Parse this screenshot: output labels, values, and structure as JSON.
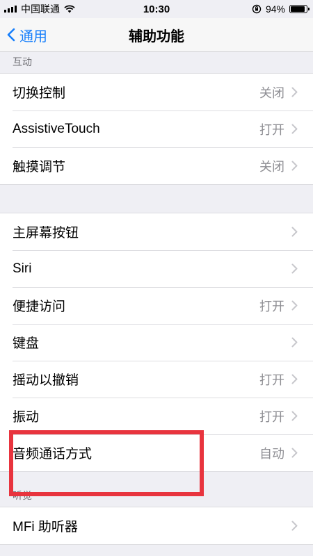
{
  "status_bar": {
    "carrier": "中国联通",
    "time": "10:30",
    "battery_text": "94%",
    "battery_level": 0.94,
    "icons": [
      "signal-icon",
      "wifi-icon",
      "orientation-lock-icon",
      "battery-icon"
    ]
  },
  "nav": {
    "back_label": "通用",
    "title": "辅助功能"
  },
  "sections": {
    "interaction": {
      "header": "互动",
      "rows": [
        {
          "label": "切换控制",
          "value": "关闭"
        },
        {
          "label": "AssistiveTouch",
          "value": "打开"
        },
        {
          "label": "触摸调节",
          "value": "关闭"
        }
      ]
    },
    "general": {
      "rows": [
        {
          "label": "主屏幕按钮",
          "value": ""
        },
        {
          "label": "Siri",
          "value": ""
        },
        {
          "label": "便捷访问",
          "value": "打开"
        },
        {
          "label": "键盘",
          "value": ""
        },
        {
          "label": "摇动以撤销",
          "value": "打开"
        },
        {
          "label": "振动",
          "value": "打开"
        },
        {
          "label": "音频通话方式",
          "value": "自动"
        }
      ]
    },
    "hearing": {
      "header": "听觉",
      "rows": [
        {
          "label": "MFi 助听器",
          "value": ""
        }
      ]
    }
  },
  "colors": {
    "accent": "#157efb",
    "highlight": "#e8343e",
    "background": "#efeff4",
    "secondary_text": "#8e8e93"
  }
}
